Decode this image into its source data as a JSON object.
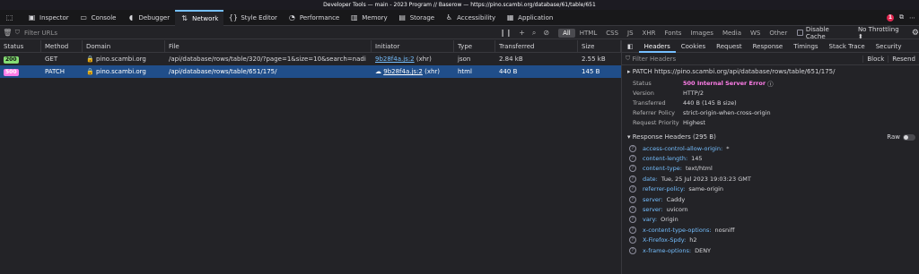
{
  "window": {
    "title": "Developer Tools — main - 2023 Program // Baserow — https://pino.scambi.org/database/61/table/651"
  },
  "toolbar": {
    "tools": [
      {
        "label": "Inspector",
        "icon": "inspector-icon"
      },
      {
        "label": "Console",
        "icon": "console-icon"
      },
      {
        "label": "Debugger",
        "icon": "debugger-icon"
      },
      {
        "label": "Network",
        "icon": "network-icon",
        "selected": true
      },
      {
        "label": "Style Editor",
        "icon": "style-editor-icon"
      },
      {
        "label": "Performance",
        "icon": "performance-icon"
      },
      {
        "label": "Memory",
        "icon": "memory-icon"
      },
      {
        "label": "Storage",
        "icon": "storage-icon"
      },
      {
        "label": "Accessibility",
        "icon": "accessibility-icon"
      },
      {
        "label": "Application",
        "icon": "application-icon"
      }
    ],
    "error_count": "1"
  },
  "filterbar": {
    "placeholder": "Filter URLs",
    "types": [
      "All",
      "HTML",
      "CSS",
      "JS",
      "XHR",
      "Fonts",
      "Images",
      "Media",
      "WS",
      "Other"
    ],
    "disable_cache": "Disable Cache",
    "throttling": "No Throttling ⬍"
  },
  "table": {
    "headers": [
      "Status",
      "Method",
      "Domain",
      "File",
      "Initiator",
      "Type",
      "Transferred",
      "Size"
    ],
    "rows": [
      {
        "status": "200",
        "method": "GET",
        "domain": "pino.scambi.org",
        "file": "/api/database/rows/table/320/?page=1&size=10&search=nadi",
        "initiator": "9b28f4a.js:2",
        "initiator_type": "(xhr)",
        "type": "json",
        "transferred": "2.84 kB",
        "size": "2.55 kB"
      },
      {
        "status": "500",
        "method": "PATCH",
        "domain": "pino.scambi.org",
        "file": "/api/database/rows/table/651/175/",
        "initiator": "9b28f4a.js:2",
        "initiator_type": "(xhr)",
        "type": "html",
        "transferred": "440 B",
        "size": "145 B"
      }
    ]
  },
  "panel": {
    "tabs": [
      "Headers",
      "Cookies",
      "Request",
      "Response",
      "Timings",
      "Stack Trace",
      "Security"
    ],
    "filter_placeholder": "Filter Headers",
    "block_label": "Block",
    "resend_label": "Resend",
    "request_line": "PATCH  https://pino.scambi.org/api/database/rows/table/651/175/",
    "summary": [
      {
        "k": "Status",
        "v": "500 Internal Server Error"
      },
      {
        "k": "Version",
        "v": "HTTP/2"
      },
      {
        "k": "Transferred",
        "v": "440 B (145 B size)"
      },
      {
        "k": "Referrer Policy",
        "v": "strict-origin-when-cross-origin"
      },
      {
        "k": "Request Priority",
        "v": "Highest"
      }
    ],
    "response_headers_label": "Response Headers (295 B)",
    "raw_label": "Raw",
    "headers": [
      {
        "k": "access-control-allow-origin:",
        "v": "*"
      },
      {
        "k": "content-length:",
        "v": "145"
      },
      {
        "k": "content-type:",
        "v": "text/html"
      },
      {
        "k": "date:",
        "v": "Tue, 25 Jul 2023 19:03:23 GMT"
      },
      {
        "k": "referrer-policy:",
        "v": "same-origin"
      },
      {
        "k": "server:",
        "v": "Caddy"
      },
      {
        "k": "server:",
        "v": "uvicorn"
      },
      {
        "k": "vary:",
        "v": "Origin"
      },
      {
        "k": "x-content-type-options:",
        "v": "nosniff"
      },
      {
        "k": "X-Firefox-Spdy:",
        "v": "h2"
      },
      {
        "k": "x-frame-options:",
        "v": "DENY"
      }
    ]
  }
}
